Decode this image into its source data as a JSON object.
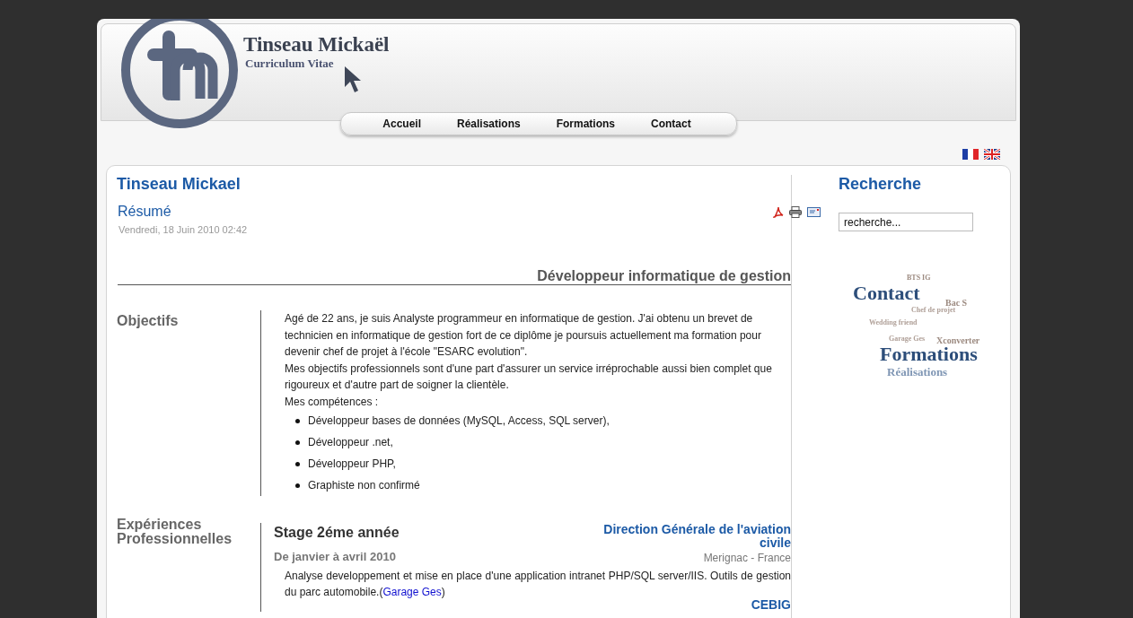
{
  "header": {
    "title": "Tinseau Mickaël",
    "subtitle": "Curriculum Vitae"
  },
  "nav": [
    {
      "label": "Accueil"
    },
    {
      "label": "Réalisations"
    },
    {
      "label": "Formations"
    },
    {
      "label": "Contact"
    }
  ],
  "article": {
    "author": "Tinseau Mickael",
    "title": "Résumé",
    "date": "Vendredi, 18 Juin 2010 02:42",
    "headline": "Développeur informatique de gestion",
    "objectives": {
      "label": "Objectifs",
      "paragraphs": [
        "Agé de 22 ans, je suis Analyste programmeur en informatique de gestion. J'ai obtenu un brevet de technicien en informatique de gestion fort de ce diplôme je poursuis actuellement ma formation pour devenir chef de projet à l'école \"ESARC evolution\".",
        "Mes objectifs professionnels sont d'une part d'assurer un service irréprochable aussi bien complet que rigoureux  et d'autre part de soigner la clientèle.",
        "Mes compétences :"
      ],
      "skills": [
        "Développeur bases de données (MySQL, Access, SQL server),",
        "Développeur .net,",
        "Développeur PHP,",
        "Graphiste non confirmé"
      ]
    },
    "experience": {
      "label": "Expériences Professionnelles",
      "items": [
        {
          "title": "Stage 2éme année",
          "company": "Direction Générale de l'aviation civile",
          "location": "Merignac - France",
          "period": "De janvier à avril 2010",
          "description": "Analyse developpement et mise en place d'une application intranet PHP/SQL server/IIS. Outils de gestion du parc automobile.(",
          "link": "Garage Ges",
          "after": ")"
        },
        {
          "company": "CEBIG"
        }
      ]
    }
  },
  "sidebar": {
    "title": "Recherche",
    "search": {
      "placeholder": "recherche..."
    },
    "tags": [
      {
        "label": "BTS IG",
        "kind": "tiny",
        "color": "#9c8a80"
      },
      {
        "label": "Contact",
        "kind": "large",
        "color": "#2d4e7a"
      },
      {
        "label": "Bac S",
        "kind": "small",
        "color": "#9c8a80"
      },
      {
        "label": "Chef de projet",
        "kind": "tiny",
        "color": "#b0a098"
      },
      {
        "label": "Wedding friend",
        "kind": "tiny",
        "color": "#b0a098"
      },
      {
        "label": "Garage Ges",
        "kind": "tiny",
        "color": "#b0a098"
      },
      {
        "label": "Xconverter",
        "kind": "small",
        "color": "#9c8a80"
      },
      {
        "label": "Formations",
        "kind": "large",
        "color": "#2d4e7a"
      },
      {
        "label": "Réalisations",
        "kind": "medium",
        "color": "#7f96b4"
      }
    ]
  }
}
